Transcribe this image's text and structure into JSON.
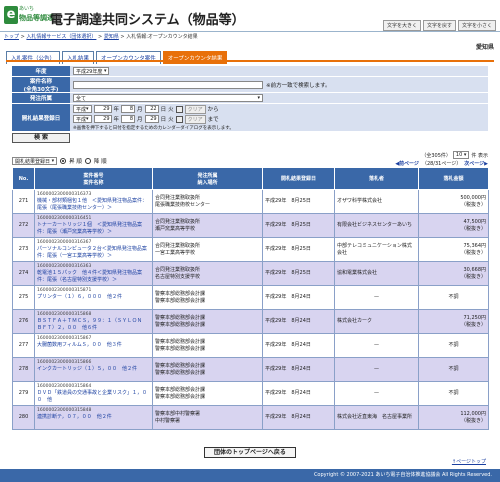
{
  "header": {
    "logo_letter": "e",
    "logo_sub": "あいち",
    "logo_name": "物品等調達",
    "title": "電子調達共同システム（物品等）",
    "font_buttons": [
      "文字を大きく",
      "文字を戻す",
      "文字を小さく"
    ]
  },
  "breadcrumb": {
    "items": [
      "トップ",
      "入札情報サービス（団体選択）",
      "愛知県",
      "入札情報:オープンカウンタ結果"
    ],
    "separators": [
      ">",
      ">",
      ">"
    ]
  },
  "prefecture": "愛知県",
  "tabs": [
    "入札案件（公告）",
    "入札結果",
    "オープンカウンタ案件",
    "オープンカウンタ結果"
  ],
  "form": {
    "year_label": "年度",
    "year_value": "平成29年度",
    "case_name_label": "案件名称",
    "case_name_sub": "(全角30文字)",
    "case_name_note": "※前方一致で検索します。",
    "agency_label": "発注所属",
    "agency_value": "全て",
    "date_label": "開札結果登録日",
    "from": {
      "era": "平成",
      "year": "29",
      "month": "8",
      "day": "22",
      "wd": "火"
    },
    "to": {
      "era": "平成",
      "year": "29",
      "month": "8",
      "day": "29",
      "wd": "火"
    },
    "year_unit": "年",
    "month_unit": "月",
    "day_unit": "日",
    "clear": "クリア",
    "from_suffix": "から",
    "to_suffix": "まで",
    "calendar_note": "※画像を押下すると日付を指定するためのカレンダーダイアログを表示します。"
  },
  "search_button": "検 索",
  "sort": {
    "field": "開札結果登録日",
    "asc": "昇 順",
    "desc": "降 順"
  },
  "count": {
    "total_text": "（全305件）",
    "per_page": "10",
    "per_page_unit": "件 表示"
  },
  "pager": {
    "prev": "◀前ページ",
    "info": "（28/31ページ）",
    "next": "次ページ▶"
  },
  "table": {
    "headers": [
      "No.",
      "案件番号\n案件名称",
      "発注所属\n納入場所",
      "開札結果登録日",
      "落札者",
      "落札金額"
    ],
    "rows": [
      {
        "no": "271",
        "id": "1600002300000316373",
        "name": "機械・部材類梱包１他　＜愛知県発注物品案件：尾張（尾張職業技術センター）＞",
        "dept": "合同発注業務取扱所\n尾張職業技術校センター",
        "date": "平成29年　8月25日",
        "winner": "オザワ科学株式会社",
        "amount": "500,000円",
        "tax": "（税抜き）"
      },
      {
        "no": "272",
        "id": "1600002300000316451",
        "name": "トナーカートリッジ１個　＜愛知県発注物品案件：尾張（瀬戸窯業高等学校）＞",
        "dept": "合同発注業務取扱所\n瀬戸窯業高等学校",
        "date": "平成29年　8月25日",
        "winner": "有限会社ビジネスセンターあいち",
        "amount": "47,500円",
        "tax": "（税抜き）"
      },
      {
        "no": "273",
        "id": "1600002300000316367",
        "name": "パーソナルコンピュータ２台＜愛知県発注物品案件：尾張（一宮工業高等学校）＞",
        "dept": "合同発注業務取扱所\n一宮工業高等学校",
        "date": "平成29年　8月25日",
        "winner": "中部テレコミュニケーション株式会社",
        "amount": "75,364円",
        "tax": "（税抜き）"
      },
      {
        "no": "274",
        "id": "1600002300000316363",
        "name": "乾電池１５パック　他４件＜愛知県発注物品案件：尾張（名古屋特別支援学校）＞",
        "dept": "合同発注業務取扱所\n名古屋特別支援学校",
        "date": "平成29年　8月25日",
        "winner": "協和電業株式会社",
        "amount": "30,668円",
        "tax": "（税抜き）"
      },
      {
        "no": "275",
        "id": "1600002300000315871",
        "name": "プリンター（１）６，０００　他２件",
        "dept": "警察本部総務部会計課\n警察本部総務部会計課",
        "date": "平成29年　8月24日",
        "winner": "—",
        "amount": "不調",
        "tax": ""
      },
      {
        "no": "276",
        "id": "1600002300000315868",
        "name": "ＢＳＴＦＡ＋ＴＭＣＳ，９９：１（ＳＹＬＯＮ　ＢＦＴ）２，００　他６件",
        "dept": "警察本部総務部会計課\n警察本部総務部会計課",
        "date": "平成29年　8月24日",
        "winner": "株式会社カーク",
        "amount": "71,250円",
        "tax": "（税抜き）"
      },
      {
        "no": "277",
        "id": "1600002300000315867",
        "name": "大腸菌数用フィルムＳ，００　他３件",
        "dept": "警察本部総務部会計課\n警察本部総務部会計課",
        "date": "平成29年　8月24日",
        "winner": "—",
        "amount": "不調",
        "tax": ""
      },
      {
        "no": "278",
        "id": "1600002300000315866",
        "name": "インクカートリッジ（１）５，００　他２件",
        "dept": "警察本部総務部会計課\n警察本部総務部会計課",
        "date": "平成29年　8月24日",
        "winner": "—",
        "amount": "不調",
        "tax": ""
      },
      {
        "no": "279",
        "id": "1600002300000315864",
        "name": "ＤＶＤ「鉄道員の交通事故と企業リスク」１，００　他",
        "dept": "警察本部総務部会計課\n警察本部総務部会計課",
        "date": "平成29年　8月24日",
        "winner": "—",
        "amount": "不調",
        "tax": ""
      },
      {
        "no": "280",
        "id": "1600002300000315848",
        "name": "連携診断テ，０７，００　他２件",
        "dept": "警察本部中村警察署\n中村警察署",
        "date": "平成29年　8月24日",
        "winner": "株式会社近直東海　名古屋事業所",
        "amount": "112,000円",
        "tax": "（税抜き）"
      }
    ]
  },
  "top_button": "団体のトップページへ戻る",
  "page_top": "↑ページトップ",
  "footer": "Copyright © 2007-2021 あいち電子自治体推進協議会  All Rights Reserved."
}
